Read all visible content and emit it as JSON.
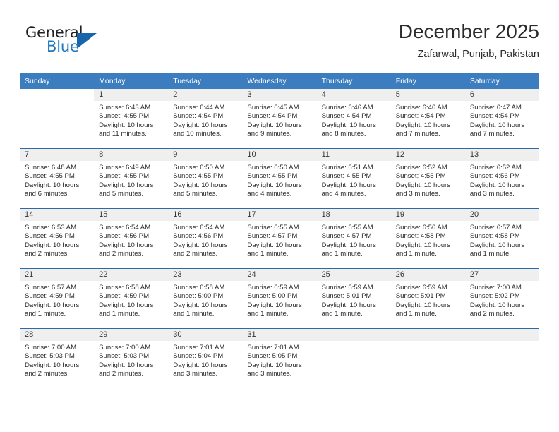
{
  "brand": {
    "name_part1": "General",
    "name_part2": "Blue",
    "logo_icon": "blue-triangle-logo"
  },
  "header": {
    "title": "December 2025",
    "subtitle": "Zafarwal, Punjab, Pakistan"
  },
  "calendar": {
    "weekday_headers": [
      "Sunday",
      "Monday",
      "Tuesday",
      "Wednesday",
      "Thursday",
      "Friday",
      "Saturday"
    ],
    "accent_color": "#3b7dbf",
    "row_divider_color": "#2b6ca8",
    "daynum_band_color": "#efefef",
    "weeks": [
      [
        {
          "day": "",
          "blank": true
        },
        {
          "day": "1",
          "sunrise": "Sunrise: 6:43 AM",
          "sunset": "Sunset: 4:55 PM",
          "daylight1": "Daylight: 10 hours",
          "daylight2": "and 11 minutes."
        },
        {
          "day": "2",
          "sunrise": "Sunrise: 6:44 AM",
          "sunset": "Sunset: 4:54 PM",
          "daylight1": "Daylight: 10 hours",
          "daylight2": "and 10 minutes."
        },
        {
          "day": "3",
          "sunrise": "Sunrise: 6:45 AM",
          "sunset": "Sunset: 4:54 PM",
          "daylight1": "Daylight: 10 hours",
          "daylight2": "and 9 minutes."
        },
        {
          "day": "4",
          "sunrise": "Sunrise: 6:46 AM",
          "sunset": "Sunset: 4:54 PM",
          "daylight1": "Daylight: 10 hours",
          "daylight2": "and 8 minutes."
        },
        {
          "day": "5",
          "sunrise": "Sunrise: 6:46 AM",
          "sunset": "Sunset: 4:54 PM",
          "daylight1": "Daylight: 10 hours",
          "daylight2": "and 7 minutes."
        },
        {
          "day": "6",
          "sunrise": "Sunrise: 6:47 AM",
          "sunset": "Sunset: 4:54 PM",
          "daylight1": "Daylight: 10 hours",
          "daylight2": "and 7 minutes."
        }
      ],
      [
        {
          "day": "7",
          "sunrise": "Sunrise: 6:48 AM",
          "sunset": "Sunset: 4:55 PM",
          "daylight1": "Daylight: 10 hours",
          "daylight2": "and 6 minutes."
        },
        {
          "day": "8",
          "sunrise": "Sunrise: 6:49 AM",
          "sunset": "Sunset: 4:55 PM",
          "daylight1": "Daylight: 10 hours",
          "daylight2": "and 5 minutes."
        },
        {
          "day": "9",
          "sunrise": "Sunrise: 6:50 AM",
          "sunset": "Sunset: 4:55 PM",
          "daylight1": "Daylight: 10 hours",
          "daylight2": "and 5 minutes."
        },
        {
          "day": "10",
          "sunrise": "Sunrise: 6:50 AM",
          "sunset": "Sunset: 4:55 PM",
          "daylight1": "Daylight: 10 hours",
          "daylight2": "and 4 minutes."
        },
        {
          "day": "11",
          "sunrise": "Sunrise: 6:51 AM",
          "sunset": "Sunset: 4:55 PM",
          "daylight1": "Daylight: 10 hours",
          "daylight2": "and 4 minutes."
        },
        {
          "day": "12",
          "sunrise": "Sunrise: 6:52 AM",
          "sunset": "Sunset: 4:55 PM",
          "daylight1": "Daylight: 10 hours",
          "daylight2": "and 3 minutes."
        },
        {
          "day": "13",
          "sunrise": "Sunrise: 6:52 AM",
          "sunset": "Sunset: 4:56 PM",
          "daylight1": "Daylight: 10 hours",
          "daylight2": "and 3 minutes."
        }
      ],
      [
        {
          "day": "14",
          "sunrise": "Sunrise: 6:53 AM",
          "sunset": "Sunset: 4:56 PM",
          "daylight1": "Daylight: 10 hours",
          "daylight2": "and 2 minutes."
        },
        {
          "day": "15",
          "sunrise": "Sunrise: 6:54 AM",
          "sunset": "Sunset: 4:56 PM",
          "daylight1": "Daylight: 10 hours",
          "daylight2": "and 2 minutes."
        },
        {
          "day": "16",
          "sunrise": "Sunrise: 6:54 AM",
          "sunset": "Sunset: 4:56 PM",
          "daylight1": "Daylight: 10 hours",
          "daylight2": "and 2 minutes."
        },
        {
          "day": "17",
          "sunrise": "Sunrise: 6:55 AM",
          "sunset": "Sunset: 4:57 PM",
          "daylight1": "Daylight: 10 hours",
          "daylight2": "and 1 minute."
        },
        {
          "day": "18",
          "sunrise": "Sunrise: 6:55 AM",
          "sunset": "Sunset: 4:57 PM",
          "daylight1": "Daylight: 10 hours",
          "daylight2": "and 1 minute."
        },
        {
          "day": "19",
          "sunrise": "Sunrise: 6:56 AM",
          "sunset": "Sunset: 4:58 PM",
          "daylight1": "Daylight: 10 hours",
          "daylight2": "and 1 minute."
        },
        {
          "day": "20",
          "sunrise": "Sunrise: 6:57 AM",
          "sunset": "Sunset: 4:58 PM",
          "daylight1": "Daylight: 10 hours",
          "daylight2": "and 1 minute."
        }
      ],
      [
        {
          "day": "21",
          "sunrise": "Sunrise: 6:57 AM",
          "sunset": "Sunset: 4:59 PM",
          "daylight1": "Daylight: 10 hours",
          "daylight2": "and 1 minute."
        },
        {
          "day": "22",
          "sunrise": "Sunrise: 6:58 AM",
          "sunset": "Sunset: 4:59 PM",
          "daylight1": "Daylight: 10 hours",
          "daylight2": "and 1 minute."
        },
        {
          "day": "23",
          "sunrise": "Sunrise: 6:58 AM",
          "sunset": "Sunset: 5:00 PM",
          "daylight1": "Daylight: 10 hours",
          "daylight2": "and 1 minute."
        },
        {
          "day": "24",
          "sunrise": "Sunrise: 6:59 AM",
          "sunset": "Sunset: 5:00 PM",
          "daylight1": "Daylight: 10 hours",
          "daylight2": "and 1 minute."
        },
        {
          "day": "25",
          "sunrise": "Sunrise: 6:59 AM",
          "sunset": "Sunset: 5:01 PM",
          "daylight1": "Daylight: 10 hours",
          "daylight2": "and 1 minute."
        },
        {
          "day": "26",
          "sunrise": "Sunrise: 6:59 AM",
          "sunset": "Sunset: 5:01 PM",
          "daylight1": "Daylight: 10 hours",
          "daylight2": "and 1 minute."
        },
        {
          "day": "27",
          "sunrise": "Sunrise: 7:00 AM",
          "sunset": "Sunset: 5:02 PM",
          "daylight1": "Daylight: 10 hours",
          "daylight2": "and 2 minutes."
        }
      ],
      [
        {
          "day": "28",
          "sunrise": "Sunrise: 7:00 AM",
          "sunset": "Sunset: 5:03 PM",
          "daylight1": "Daylight: 10 hours",
          "daylight2": "and 2 minutes."
        },
        {
          "day": "29",
          "sunrise": "Sunrise: 7:00 AM",
          "sunset": "Sunset: 5:03 PM",
          "daylight1": "Daylight: 10 hours",
          "daylight2": "and 2 minutes."
        },
        {
          "day": "30",
          "sunrise": "Sunrise: 7:01 AM",
          "sunset": "Sunset: 5:04 PM",
          "daylight1": "Daylight: 10 hours",
          "daylight2": "and 3 minutes."
        },
        {
          "day": "31",
          "sunrise": "Sunrise: 7:01 AM",
          "sunset": "Sunset: 5:05 PM",
          "daylight1": "Daylight: 10 hours",
          "daylight2": "and 3 minutes."
        },
        {
          "day": "",
          "empty": true
        },
        {
          "day": "",
          "empty": true
        },
        {
          "day": "",
          "empty": true
        }
      ]
    ]
  }
}
